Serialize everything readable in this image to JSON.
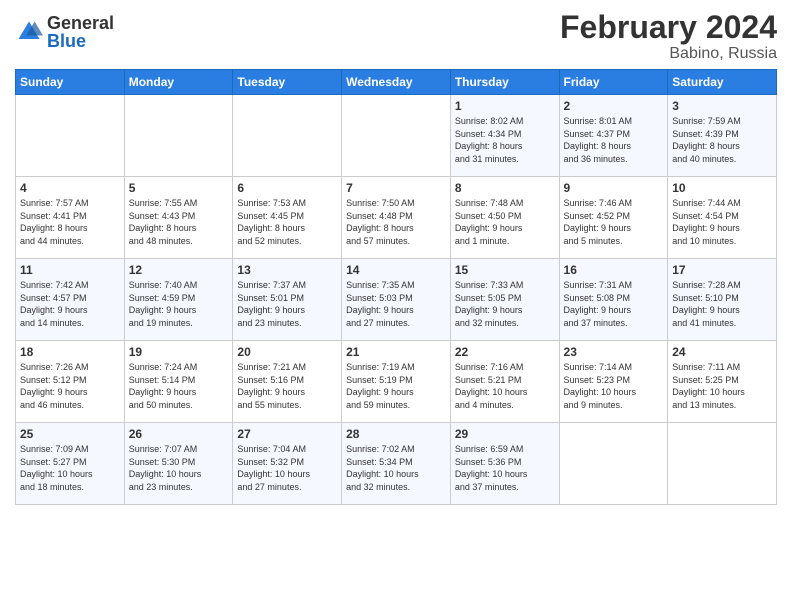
{
  "logo": {
    "general": "General",
    "blue": "Blue"
  },
  "title": {
    "month_year": "February 2024",
    "location": "Babino, Russia"
  },
  "headers": [
    "Sunday",
    "Monday",
    "Tuesday",
    "Wednesday",
    "Thursday",
    "Friday",
    "Saturday"
  ],
  "weeks": [
    [
      {
        "day": "",
        "info": ""
      },
      {
        "day": "",
        "info": ""
      },
      {
        "day": "",
        "info": ""
      },
      {
        "day": "",
        "info": ""
      },
      {
        "day": "1",
        "info": "Sunrise: 8:02 AM\nSunset: 4:34 PM\nDaylight: 8 hours\nand 31 minutes."
      },
      {
        "day": "2",
        "info": "Sunrise: 8:01 AM\nSunset: 4:37 PM\nDaylight: 8 hours\nand 36 minutes."
      },
      {
        "day": "3",
        "info": "Sunrise: 7:59 AM\nSunset: 4:39 PM\nDaylight: 8 hours\nand 40 minutes."
      }
    ],
    [
      {
        "day": "4",
        "info": "Sunrise: 7:57 AM\nSunset: 4:41 PM\nDaylight: 8 hours\nand 44 minutes."
      },
      {
        "day": "5",
        "info": "Sunrise: 7:55 AM\nSunset: 4:43 PM\nDaylight: 8 hours\nand 48 minutes."
      },
      {
        "day": "6",
        "info": "Sunrise: 7:53 AM\nSunset: 4:45 PM\nDaylight: 8 hours\nand 52 minutes."
      },
      {
        "day": "7",
        "info": "Sunrise: 7:50 AM\nSunset: 4:48 PM\nDaylight: 8 hours\nand 57 minutes."
      },
      {
        "day": "8",
        "info": "Sunrise: 7:48 AM\nSunset: 4:50 PM\nDaylight: 9 hours\nand 1 minute."
      },
      {
        "day": "9",
        "info": "Sunrise: 7:46 AM\nSunset: 4:52 PM\nDaylight: 9 hours\nand 5 minutes."
      },
      {
        "day": "10",
        "info": "Sunrise: 7:44 AM\nSunset: 4:54 PM\nDaylight: 9 hours\nand 10 minutes."
      }
    ],
    [
      {
        "day": "11",
        "info": "Sunrise: 7:42 AM\nSunset: 4:57 PM\nDaylight: 9 hours\nand 14 minutes."
      },
      {
        "day": "12",
        "info": "Sunrise: 7:40 AM\nSunset: 4:59 PM\nDaylight: 9 hours\nand 19 minutes."
      },
      {
        "day": "13",
        "info": "Sunrise: 7:37 AM\nSunset: 5:01 PM\nDaylight: 9 hours\nand 23 minutes."
      },
      {
        "day": "14",
        "info": "Sunrise: 7:35 AM\nSunset: 5:03 PM\nDaylight: 9 hours\nand 27 minutes."
      },
      {
        "day": "15",
        "info": "Sunrise: 7:33 AM\nSunset: 5:05 PM\nDaylight: 9 hours\nand 32 minutes."
      },
      {
        "day": "16",
        "info": "Sunrise: 7:31 AM\nSunset: 5:08 PM\nDaylight: 9 hours\nand 37 minutes."
      },
      {
        "day": "17",
        "info": "Sunrise: 7:28 AM\nSunset: 5:10 PM\nDaylight: 9 hours\nand 41 minutes."
      }
    ],
    [
      {
        "day": "18",
        "info": "Sunrise: 7:26 AM\nSunset: 5:12 PM\nDaylight: 9 hours\nand 46 minutes."
      },
      {
        "day": "19",
        "info": "Sunrise: 7:24 AM\nSunset: 5:14 PM\nDaylight: 9 hours\nand 50 minutes."
      },
      {
        "day": "20",
        "info": "Sunrise: 7:21 AM\nSunset: 5:16 PM\nDaylight: 9 hours\nand 55 minutes."
      },
      {
        "day": "21",
        "info": "Sunrise: 7:19 AM\nSunset: 5:19 PM\nDaylight: 9 hours\nand 59 minutes."
      },
      {
        "day": "22",
        "info": "Sunrise: 7:16 AM\nSunset: 5:21 PM\nDaylight: 10 hours\nand 4 minutes."
      },
      {
        "day": "23",
        "info": "Sunrise: 7:14 AM\nSunset: 5:23 PM\nDaylight: 10 hours\nand 9 minutes."
      },
      {
        "day": "24",
        "info": "Sunrise: 7:11 AM\nSunset: 5:25 PM\nDaylight: 10 hours\nand 13 minutes."
      }
    ],
    [
      {
        "day": "25",
        "info": "Sunrise: 7:09 AM\nSunset: 5:27 PM\nDaylight: 10 hours\nand 18 minutes."
      },
      {
        "day": "26",
        "info": "Sunrise: 7:07 AM\nSunset: 5:30 PM\nDaylight: 10 hours\nand 23 minutes."
      },
      {
        "day": "27",
        "info": "Sunrise: 7:04 AM\nSunset: 5:32 PM\nDaylight: 10 hours\nand 27 minutes."
      },
      {
        "day": "28",
        "info": "Sunrise: 7:02 AM\nSunset: 5:34 PM\nDaylight: 10 hours\nand 32 minutes."
      },
      {
        "day": "29",
        "info": "Sunrise: 6:59 AM\nSunset: 5:36 PM\nDaylight: 10 hours\nand 37 minutes."
      },
      {
        "day": "",
        "info": ""
      },
      {
        "day": "",
        "info": ""
      }
    ]
  ]
}
